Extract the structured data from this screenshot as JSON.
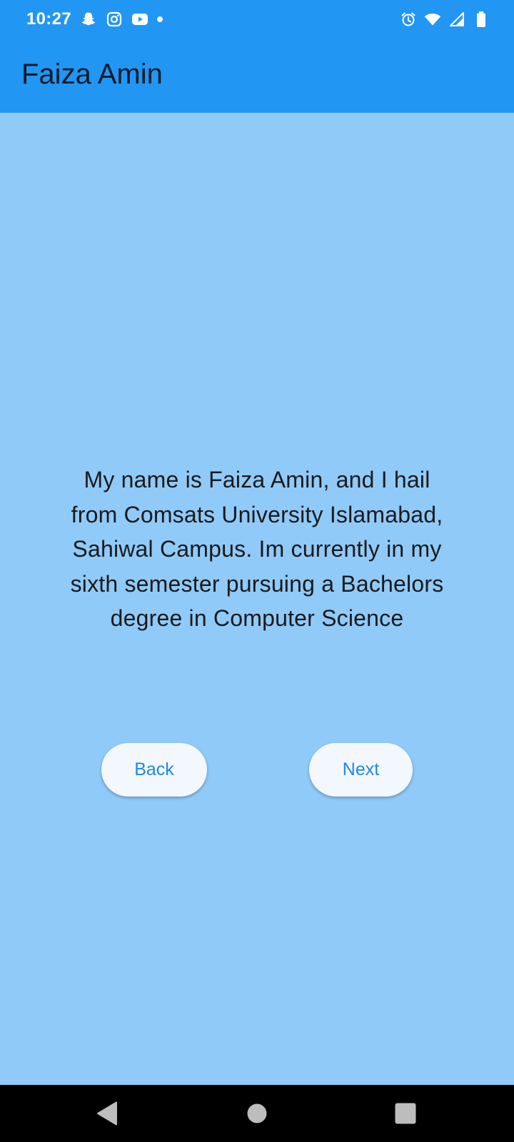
{
  "status_bar": {
    "time": "10:27",
    "left_icons": [
      "snapchat-icon",
      "instagram-icon",
      "youtube-icon",
      "notification-dot-icon"
    ],
    "right_icons": [
      "alarm-icon",
      "wifi-icon",
      "cell-signal-icon",
      "battery-icon"
    ]
  },
  "app_bar": {
    "title": "Faiza Amin"
  },
  "content": {
    "intro": "My name is Faiza Amin, and I hail from Comsats University Islamabad, Sahiwal Campus. Im currently in my sixth semester pursuing a Bachelors degree in Computer Science"
  },
  "buttons": {
    "back_label": "Back",
    "next_label": "Next"
  },
  "nav_bar": {
    "icons": [
      "back-triangle-icon",
      "home-circle-icon",
      "recents-square-icon"
    ]
  },
  "colors": {
    "app_bar": "#2196f3",
    "background": "#90caf9",
    "button_background": "#f3f8fe",
    "button_text": "#1e88e5",
    "nav_bar": "#000000"
  }
}
